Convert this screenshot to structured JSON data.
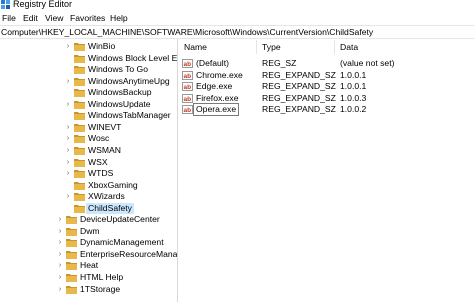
{
  "window": {
    "title": "Registry Editor"
  },
  "menu": [
    "File",
    "Edit",
    "View",
    "Favorites",
    "Help"
  ],
  "address": "Computer\\HKEY_LOCAL_MACHINE\\SOFTWARE\\Microsoft\\Windows\\CurrentVersion\\ChildSafety",
  "tree": [
    {
      "label": "WinBio",
      "expandable": true
    },
    {
      "label": "Windows Block Level E",
      "expandable": false
    },
    {
      "label": "Windows To Go",
      "expandable": false
    },
    {
      "label": "WindowsAnytimeUpg",
      "expandable": true
    },
    {
      "label": "WindowsBackup",
      "expandable": false
    },
    {
      "label": "WindowsUpdate",
      "expandable": true
    },
    {
      "label": "WindowsTabManager",
      "expandable": false
    },
    {
      "label": "WINEVT",
      "expandable": true
    },
    {
      "label": "Wosc",
      "expandable": true
    },
    {
      "label": "WSMAN",
      "expandable": true
    },
    {
      "label": "WSX",
      "expandable": true
    },
    {
      "label": "WTDS",
      "expandable": true
    },
    {
      "label": "XboxGaming",
      "expandable": false
    },
    {
      "label": "XWizards",
      "expandable": true
    },
    {
      "label": "ChildSafety",
      "expandable": false,
      "selected": true
    },
    {
      "label": "DeviceUpdateCenter",
      "expandable": true
    },
    {
      "label": "Dwm",
      "expandable": true
    },
    {
      "label": "DynamicManagement",
      "expandable": true
    },
    {
      "label": "EnterpriseResourceManag",
      "expandable": true
    },
    {
      "label": "Heat",
      "expandable": true
    },
    {
      "label": "HTML Help",
      "expandable": true
    },
    {
      "label": "1TStorage",
      "expandable": true
    }
  ],
  "columns": {
    "name": "Name",
    "type": "Type",
    "data": "Data"
  },
  "values": [
    {
      "name": "(Default)",
      "type": "REG_SZ",
      "data": "(value not set)"
    },
    {
      "name": "Chrome.exe",
      "type": "REG_EXPAND_SZ",
      "data": "1.0.0.1"
    },
    {
      "name": "Edge.exe",
      "type": "REG_EXPAND_SZ",
      "data": "1.0.0.1"
    },
    {
      "name": "Firefox.exe",
      "type": "REG_EXPAND_SZ",
      "data": "1.0.0.3"
    },
    {
      "name": "Opera.exe",
      "type": "REG_EXPAND_SZ",
      "data": "1.0.0.2",
      "focused": true
    }
  ],
  "icons": {
    "app": "registry-icon",
    "folder": "folder-icon",
    "value": "string-value-icon",
    "expander": "chevron-right-icon"
  },
  "colors": {
    "folder": "#e8b84a",
    "folder_dark": "#c9962a",
    "selection": "#cce8ff",
    "value_icon": "#c0392b"
  }
}
